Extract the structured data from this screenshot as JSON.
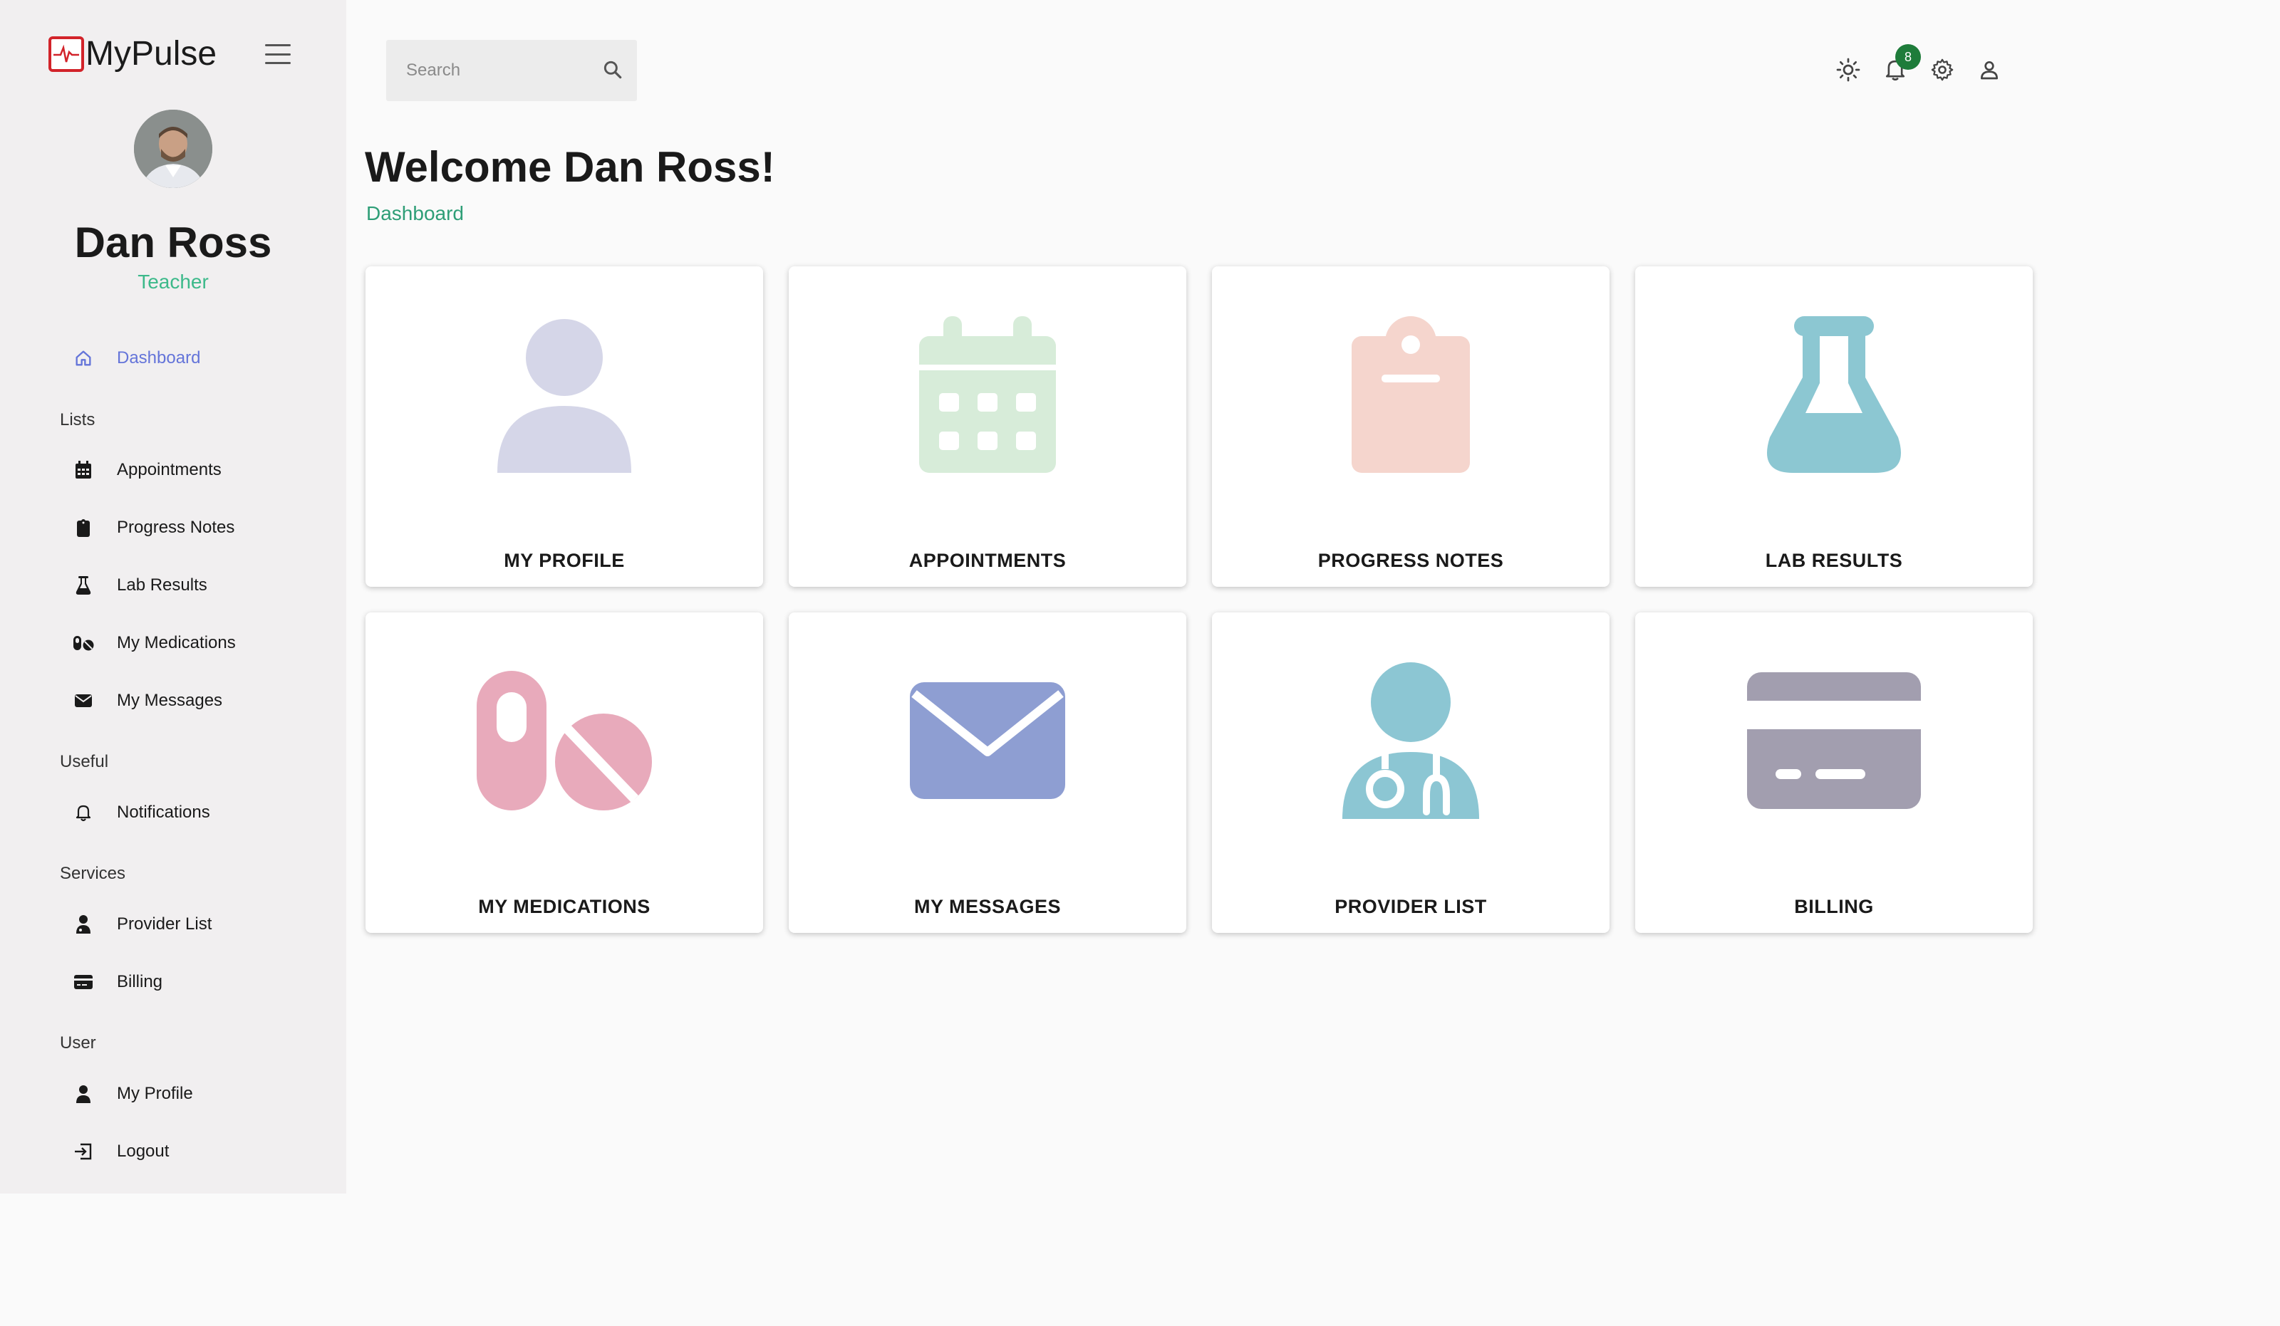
{
  "brand": {
    "name": "MyPulse"
  },
  "user": {
    "name": "Dan Ross",
    "role": "Teacher"
  },
  "sidebar": {
    "dashboard": "Dashboard",
    "sections": {
      "lists": "Lists",
      "useful": "Useful",
      "services": "Services",
      "user": "User"
    },
    "items": {
      "appointments": "Appointments",
      "progress_notes": "Progress Notes",
      "lab_results": "Lab Results",
      "my_medications": "My Medications",
      "my_messages": "My Messages",
      "notifications": "Notifications",
      "provider_list": "Provider List",
      "billing": "Billing",
      "my_profile": "My Profile",
      "logout": "Logout"
    }
  },
  "topbar": {
    "search_placeholder": "Search",
    "notification_count": "8"
  },
  "main": {
    "welcome": "Welcome Dan Ross!",
    "breadcrumb": "Dashboard",
    "tiles": [
      {
        "label": "MY PROFILE",
        "icon": "person-icon",
        "color": "#d5d6e8"
      },
      {
        "label": "APPOINTMENTS",
        "icon": "calendar-icon",
        "color": "#d7ecd9"
      },
      {
        "label": "PROGRESS NOTES",
        "icon": "clipboard-icon",
        "color": "#f5d5cd"
      },
      {
        "label": "LAB RESULTS",
        "icon": "flask-icon",
        "color": "#8cc7d2"
      },
      {
        "label": "MY MEDICATIONS",
        "icon": "pills-icon",
        "color": "#e8aabb"
      },
      {
        "label": "MY MESSAGES",
        "icon": "envelope-icon",
        "color": "#8e9ed2"
      },
      {
        "label": "PROVIDER LIST",
        "icon": "doctor-icon",
        "color": "#8cc6d3"
      },
      {
        "label": "BILLING",
        "icon": "credit-card-icon",
        "color": "#a29eaf"
      }
    ]
  },
  "colors": {
    "accent_green": "#3cb98a",
    "active_nav": "#6474d9",
    "badge": "#1e7c3a",
    "logo_red": "#d2232a"
  }
}
